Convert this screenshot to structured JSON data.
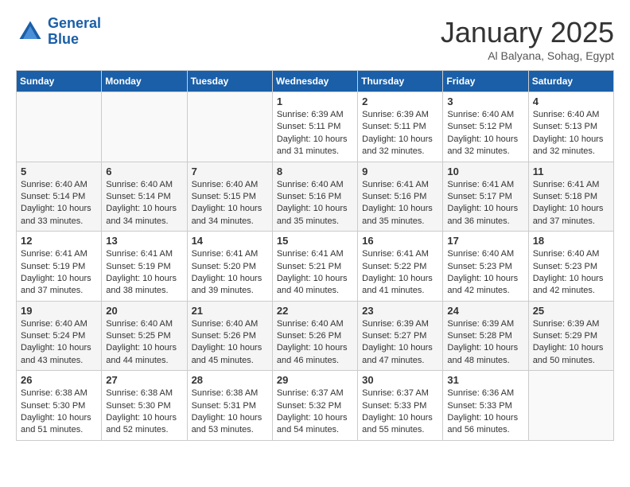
{
  "header": {
    "logo_line1": "General",
    "logo_line2": "Blue",
    "month": "January 2025",
    "location": "Al Balyana, Sohag, Egypt"
  },
  "days_of_week": [
    "Sunday",
    "Monday",
    "Tuesday",
    "Wednesday",
    "Thursday",
    "Friday",
    "Saturday"
  ],
  "weeks": [
    [
      {
        "day": "",
        "info": ""
      },
      {
        "day": "",
        "info": ""
      },
      {
        "day": "",
        "info": ""
      },
      {
        "day": "1",
        "sunrise": "6:39 AM",
        "sunset": "5:11 PM",
        "daylight": "10 hours and 31 minutes."
      },
      {
        "day": "2",
        "sunrise": "6:39 AM",
        "sunset": "5:11 PM",
        "daylight": "10 hours and 32 minutes."
      },
      {
        "day": "3",
        "sunrise": "6:40 AM",
        "sunset": "5:12 PM",
        "daylight": "10 hours and 32 minutes."
      },
      {
        "day": "4",
        "sunrise": "6:40 AM",
        "sunset": "5:13 PM",
        "daylight": "10 hours and 32 minutes."
      }
    ],
    [
      {
        "day": "5",
        "sunrise": "6:40 AM",
        "sunset": "5:14 PM",
        "daylight": "10 hours and 33 minutes."
      },
      {
        "day": "6",
        "sunrise": "6:40 AM",
        "sunset": "5:14 PM",
        "daylight": "10 hours and 34 minutes."
      },
      {
        "day": "7",
        "sunrise": "6:40 AM",
        "sunset": "5:15 PM",
        "daylight": "10 hours and 34 minutes."
      },
      {
        "day": "8",
        "sunrise": "6:40 AM",
        "sunset": "5:16 PM",
        "daylight": "10 hours and 35 minutes."
      },
      {
        "day": "9",
        "sunrise": "6:41 AM",
        "sunset": "5:16 PM",
        "daylight": "10 hours and 35 minutes."
      },
      {
        "day": "10",
        "sunrise": "6:41 AM",
        "sunset": "5:17 PM",
        "daylight": "10 hours and 36 minutes."
      },
      {
        "day": "11",
        "sunrise": "6:41 AM",
        "sunset": "5:18 PM",
        "daylight": "10 hours and 37 minutes."
      }
    ],
    [
      {
        "day": "12",
        "sunrise": "6:41 AM",
        "sunset": "5:19 PM",
        "daylight": "10 hours and 37 minutes."
      },
      {
        "day": "13",
        "sunrise": "6:41 AM",
        "sunset": "5:19 PM",
        "daylight": "10 hours and 38 minutes."
      },
      {
        "day": "14",
        "sunrise": "6:41 AM",
        "sunset": "5:20 PM",
        "daylight": "10 hours and 39 minutes."
      },
      {
        "day": "15",
        "sunrise": "6:41 AM",
        "sunset": "5:21 PM",
        "daylight": "10 hours and 40 minutes."
      },
      {
        "day": "16",
        "sunrise": "6:41 AM",
        "sunset": "5:22 PM",
        "daylight": "10 hours and 41 minutes."
      },
      {
        "day": "17",
        "sunrise": "6:40 AM",
        "sunset": "5:23 PM",
        "daylight": "10 hours and 42 minutes."
      },
      {
        "day": "18",
        "sunrise": "6:40 AM",
        "sunset": "5:23 PM",
        "daylight": "10 hours and 42 minutes."
      }
    ],
    [
      {
        "day": "19",
        "sunrise": "6:40 AM",
        "sunset": "5:24 PM",
        "daylight": "10 hours and 43 minutes."
      },
      {
        "day": "20",
        "sunrise": "6:40 AM",
        "sunset": "5:25 PM",
        "daylight": "10 hours and 44 minutes."
      },
      {
        "day": "21",
        "sunrise": "6:40 AM",
        "sunset": "5:26 PM",
        "daylight": "10 hours and 45 minutes."
      },
      {
        "day": "22",
        "sunrise": "6:40 AM",
        "sunset": "5:26 PM",
        "daylight": "10 hours and 46 minutes."
      },
      {
        "day": "23",
        "sunrise": "6:39 AM",
        "sunset": "5:27 PM",
        "daylight": "10 hours and 47 minutes."
      },
      {
        "day": "24",
        "sunrise": "6:39 AM",
        "sunset": "5:28 PM",
        "daylight": "10 hours and 48 minutes."
      },
      {
        "day": "25",
        "sunrise": "6:39 AM",
        "sunset": "5:29 PM",
        "daylight": "10 hours and 50 minutes."
      }
    ],
    [
      {
        "day": "26",
        "sunrise": "6:38 AM",
        "sunset": "5:30 PM",
        "daylight": "10 hours and 51 minutes."
      },
      {
        "day": "27",
        "sunrise": "6:38 AM",
        "sunset": "5:30 PM",
        "daylight": "10 hours and 52 minutes."
      },
      {
        "day": "28",
        "sunrise": "6:38 AM",
        "sunset": "5:31 PM",
        "daylight": "10 hours and 53 minutes."
      },
      {
        "day": "29",
        "sunrise": "6:37 AM",
        "sunset": "5:32 PM",
        "daylight": "10 hours and 54 minutes."
      },
      {
        "day": "30",
        "sunrise": "6:37 AM",
        "sunset": "5:33 PM",
        "daylight": "10 hours and 55 minutes."
      },
      {
        "day": "31",
        "sunrise": "6:36 AM",
        "sunset": "5:33 PM",
        "daylight": "10 hours and 56 minutes."
      },
      {
        "day": "",
        "info": ""
      }
    ]
  ]
}
